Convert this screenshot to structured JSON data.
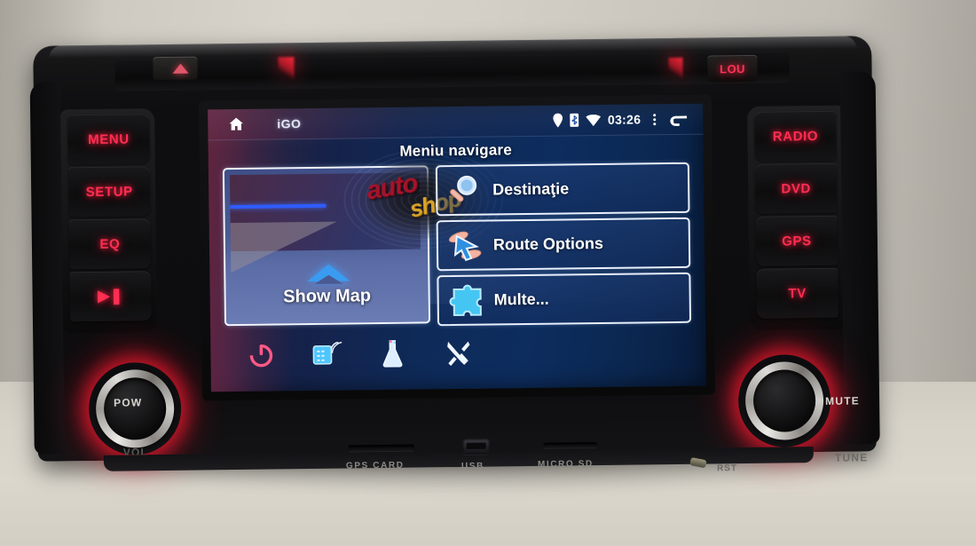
{
  "device": {
    "type": "car-head-unit",
    "top_strip": {
      "eject_label": "eject",
      "lou_label": "LOU"
    },
    "left_buttons": [
      {
        "id": "menu",
        "label": "MENU"
      },
      {
        "id": "setup",
        "label": "SETUP"
      },
      {
        "id": "eq",
        "label": "EQ"
      },
      {
        "id": "play",
        "label": "▶❚"
      }
    ],
    "right_buttons": [
      {
        "id": "radio",
        "label": "RADIO"
      },
      {
        "id": "dvd",
        "label": "DVD"
      },
      {
        "id": "gps",
        "label": "GPS"
      },
      {
        "id": "tv",
        "label": "TV"
      }
    ],
    "knobs": {
      "left": {
        "top_label": "POW",
        "bottom_label": "VOL"
      },
      "right": {
        "top_label": "MUTE",
        "bottom_label": "TUNE"
      }
    },
    "ports": [
      {
        "id": "gps-card",
        "label": "GPS CARD"
      },
      {
        "id": "usb",
        "label": "USB"
      },
      {
        "id": "micro-sd",
        "label": "MICRO SD"
      }
    ],
    "reset_label": "RST",
    "accent_color": "#ff2e52"
  },
  "screen": {
    "statusbar": {
      "home_icon": "home-icon",
      "app_name": "iGO",
      "icons": [
        "location-pin-icon",
        "bluetooth-icon",
        "wifi-icon"
      ],
      "time": "03:26",
      "overflow_icon": "overflow-menu-icon",
      "back_icon": "back-arrow-icon"
    },
    "title": "Meniu navigare",
    "map_panel": {
      "label": "Show Map"
    },
    "menu_items": [
      {
        "id": "destination",
        "label": "Destinaţie",
        "icon": "magnifier-icon"
      },
      {
        "id": "route-options",
        "label": "Route Options",
        "icon": "cursor-hand-icon"
      },
      {
        "id": "more",
        "label": "Multe...",
        "icon": "puzzle-piece-icon"
      }
    ],
    "tray_icons": [
      {
        "id": "power",
        "icon": "power-icon",
        "color": "#ff5a86"
      },
      {
        "id": "gps-sat",
        "icon": "satellite-icon",
        "color": "#49c8ff"
      },
      {
        "id": "beaker",
        "icon": "flask-icon",
        "color": "#cfe6ff"
      },
      {
        "id": "settings",
        "icon": "tools-icon",
        "color": "#e8f2ff"
      }
    ],
    "screen_bg_color": "#0d2d5f",
    "text_color": "#ffffff"
  },
  "watermark": {
    "line1": "auto",
    "line2": "shop"
  }
}
